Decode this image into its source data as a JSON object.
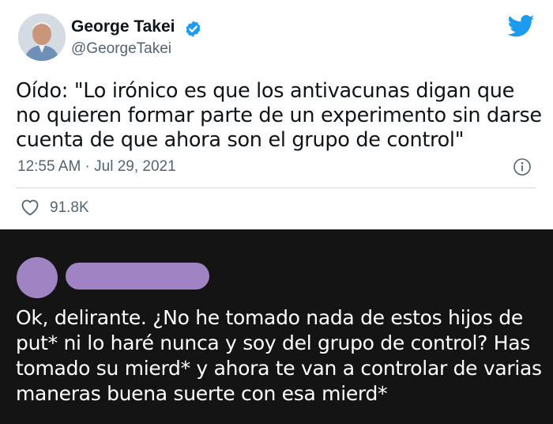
{
  "tweet": {
    "author_name": "George Takei",
    "author_handle": "@GeorgeTakei",
    "text": "Oído: \"Lo irónico es que los antivacunas digan que no quieren formar parte de un experimento sin darse cuenta de que ahora son el grupo de control\"",
    "timestamp": "12:55 AM · Jul 29, 2021",
    "like_count": "91.8K",
    "icons": [
      "verified-icon",
      "twitter-bird-icon",
      "info-icon",
      "heart-icon"
    ],
    "colors": {
      "verified": "#1d9bf0",
      "brand": "#1d9bf0",
      "secondary_text": "#536471"
    }
  },
  "reply": {
    "text": "Ok, delirante. ¿No he tomado nada de estos hijos de put* ni lo haré nunca y soy del grupo de control? Has tomado su mierd* y ahora te van a controlar de varias maneras buena suerte con esa mierd*",
    "colors": {
      "background": "#141414",
      "redaction": "#a083c2",
      "text": "#ffffff"
    }
  }
}
